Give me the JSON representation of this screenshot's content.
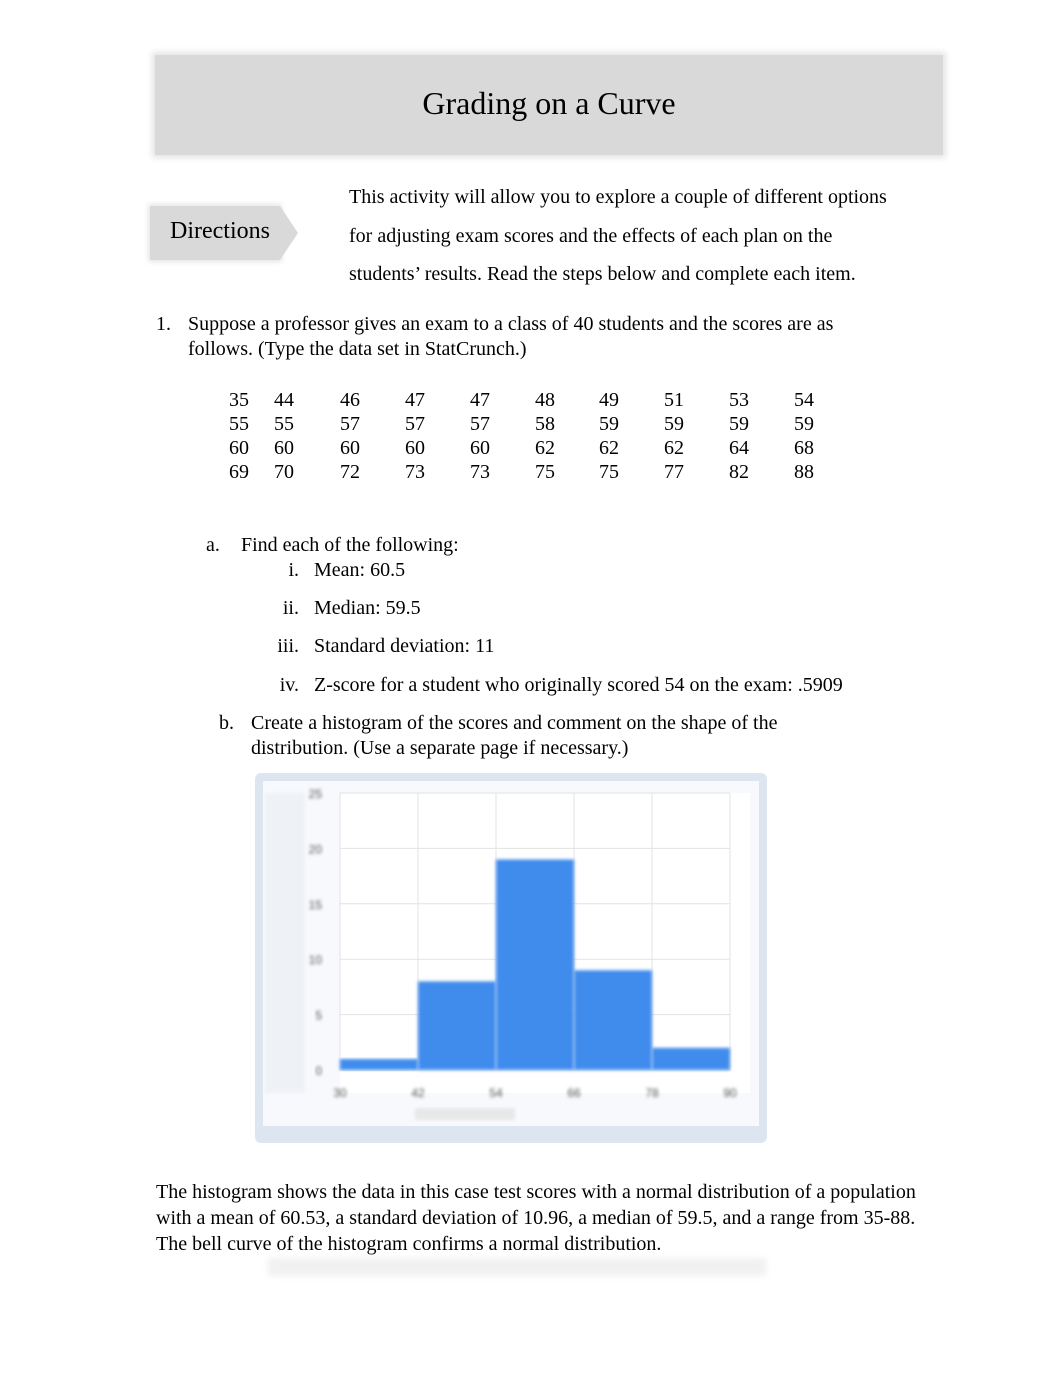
{
  "title": "Grading on a Curve",
  "directions_label": "Directions",
  "intro": "This activity will allow you to explore a couple of different options for adjusting exam scores and the effects of each plan on the students’ results. Read the steps below and complete each item.",
  "q1": {
    "number": "1.",
    "line1": "Suppose a professor gives an exam to a class of 40 students and the scores are as",
    "line2": "follows. (Type the data set in StatCrunch.)"
  },
  "scores": [
    [
      "35",
      "44",
      "46",
      "47",
      "47",
      "48",
      "49",
      "51",
      "53",
      "54"
    ],
    [
      "55",
      "55",
      "57",
      "57",
      "57",
      "58",
      "59",
      "59",
      "59",
      "59"
    ],
    [
      "60",
      "60",
      "60",
      "60",
      "60",
      "62",
      "62",
      "62",
      "64",
      "68"
    ],
    [
      "69",
      "70",
      "72",
      "73",
      "73",
      "75",
      "75",
      "77",
      "82",
      "88"
    ]
  ],
  "part_a": {
    "marker": "a.",
    "text": "Find each of the following:",
    "items": [
      {
        "marker": "i.",
        "text": "Mean: 60.5"
      },
      {
        "marker": "ii.",
        "text": "Median: 59.5"
      },
      {
        "marker": "iii.",
        "text": "Standard deviation: 11"
      },
      {
        "marker": "iv.",
        "text": "Z-score for a student who originally scored 54 on the exam: .5909"
      }
    ]
  },
  "part_b": {
    "marker": "b.",
    "line1": "Create a histogram of the scores and comment on the shape of the",
    "line2": "distribution. (Use a separate page if necessary.)"
  },
  "chart_data": {
    "type": "bar",
    "bins": [
      [
        30,
        42
      ],
      [
        42,
        54
      ],
      [
        54,
        66
      ],
      [
        66,
        78
      ],
      [
        78,
        90
      ]
    ],
    "values": [
      1,
      8,
      19,
      9,
      2
    ],
    "x_ticks": [
      "30",
      "42",
      "54",
      "66",
      "78",
      "90"
    ],
    "y_ticks": [
      "0",
      "5",
      "10",
      "15",
      "20",
      "25"
    ],
    "xlim": [
      30,
      90
    ],
    "ylim": [
      0,
      25
    ],
    "grid": true,
    "bar_color": "#3f8ced"
  },
  "conclusion": "The histogram shows the data in this case test scores with a normal distribution of a population with a mean of 60.53, a standard deviation of 10.96, a median of 59.5,    and a range from 35-88. The bell curve of the histogram confirms a normal distribution."
}
